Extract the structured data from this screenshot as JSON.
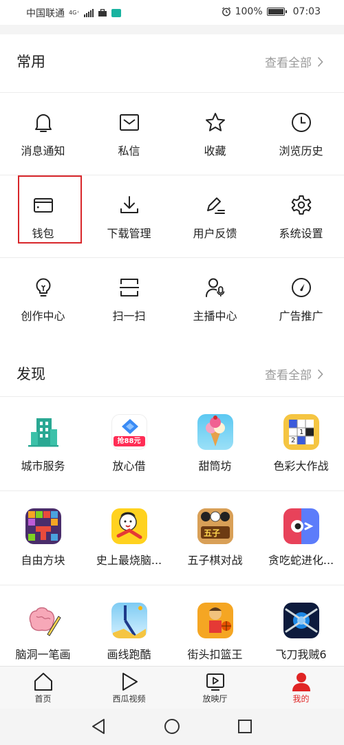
{
  "status_bar": {
    "carrier": "中国联通",
    "network": "4G⁺",
    "battery_percent": "100%",
    "time": "07:03",
    "alarm_icon": "alarm-icon"
  },
  "common": {
    "title": "常用",
    "see_all": "查看全部",
    "items": [
      {
        "label": "消息通知",
        "icon": "bell-icon"
      },
      {
        "label": "私信",
        "icon": "mail-icon"
      },
      {
        "label": "收藏",
        "icon": "star-icon"
      },
      {
        "label": "浏览历史",
        "icon": "clock-icon"
      },
      {
        "label": "钱包",
        "icon": "wallet-icon"
      },
      {
        "label": "下载管理",
        "icon": "download-icon"
      },
      {
        "label": "用户反馈",
        "icon": "feedback-pen-icon"
      },
      {
        "label": "系统设置",
        "icon": "gear-icon"
      },
      {
        "label": "创作中心",
        "icon": "lightbulb-icon"
      },
      {
        "label": "扫一扫",
        "icon": "scan-icon"
      },
      {
        "label": "主播中心",
        "icon": "anchor-mic-icon"
      },
      {
        "label": "广告推广",
        "icon": "gauge-icon"
      }
    ]
  },
  "discover": {
    "title": "发现",
    "see_all": "查看全部",
    "items": [
      {
        "label": "城市服务",
        "icon": "city-building-icon"
      },
      {
        "label": "放心借",
        "icon": "loan-app-icon",
        "badge": "抢88元"
      },
      {
        "label": "甜筒坊",
        "icon": "ice-cream-game-icon"
      },
      {
        "label": "色彩大作战",
        "icon": "color-grid-game-icon"
      },
      {
        "label": "自由方块",
        "icon": "block-puzzle-game-icon"
      },
      {
        "label": "史上最烧脑...",
        "icon": "brain-game-icon"
      },
      {
        "label": "五子棋对战",
        "icon": "gomoku-game-icon"
      },
      {
        "label": "贪吃蛇进化...",
        "icon": "snake-game-icon"
      },
      {
        "label": "脑洞一笔画",
        "icon": "brain-draw-game-icon"
      },
      {
        "label": "画线跑酷",
        "icon": "line-parkour-game-icon"
      },
      {
        "label": "街头扣篮王",
        "icon": "basketball-game-icon"
      },
      {
        "label": "飞刀我贼6",
        "icon": "flying-knife-game-icon"
      }
    ]
  },
  "tabbar": {
    "tabs": [
      {
        "label": "首页",
        "icon": "home-icon"
      },
      {
        "label": "西瓜视频",
        "icon": "play-icon"
      },
      {
        "label": "放映厅",
        "icon": "tv-play-icon"
      },
      {
        "label": "我的",
        "icon": "person-icon",
        "active": true
      }
    ],
    "active_color": "#e02424"
  },
  "navbar": {
    "buttons": [
      "back-triangle-icon",
      "home-circle-icon",
      "recents-square-icon"
    ]
  },
  "highlight_color": "#d8262a"
}
